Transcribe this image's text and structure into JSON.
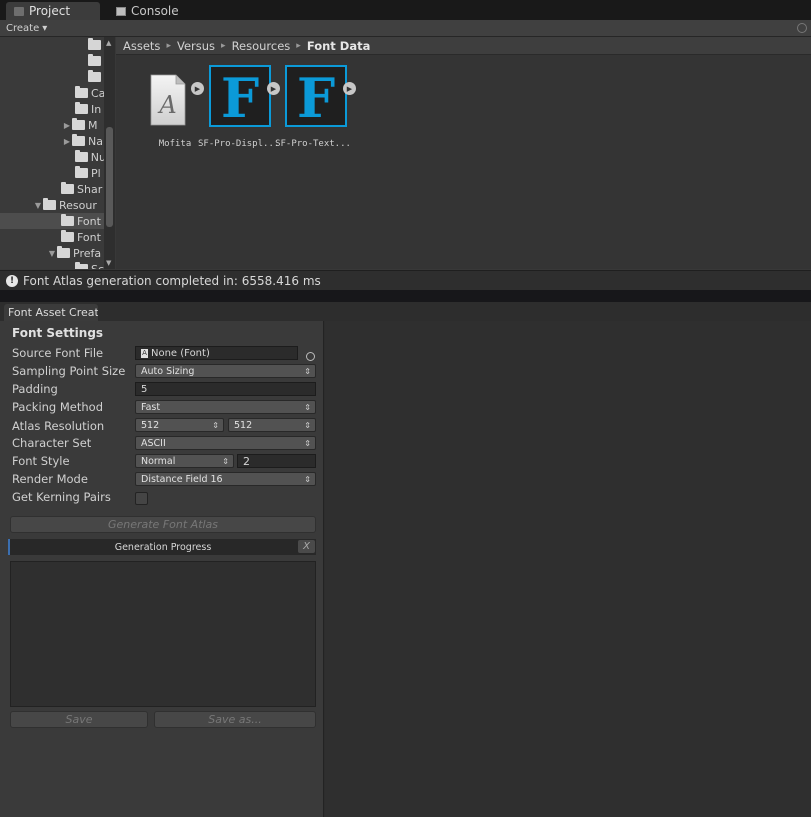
{
  "project": {
    "tabs": {
      "project": "Project",
      "console": "Console"
    },
    "toolbar": {
      "create": "Create",
      "create_arrow": "▾"
    },
    "tree": [
      {
        "label": "",
        "arrow": ""
      },
      {
        "label": "",
        "arrow": ""
      },
      {
        "label": "",
        "arrow": ""
      },
      {
        "label": "Ca",
        "arrow": ""
      },
      {
        "label": "In",
        "arrow": ""
      },
      {
        "label": "M",
        "arrow": "▶"
      },
      {
        "label": "Na",
        "arrow": "▶"
      },
      {
        "label": "Nu",
        "arrow": ""
      },
      {
        "label": "Pl",
        "arrow": ""
      },
      {
        "label": "Shar",
        "arrow": ""
      },
      {
        "label": "Resour",
        "arrow": "▼"
      },
      {
        "label": "Font",
        "arrow": ""
      },
      {
        "label": "Font",
        "arrow": ""
      },
      {
        "label": "Prefa",
        "arrow": "▼"
      },
      {
        "label": "Sc",
        "arrow": ""
      }
    ],
    "breadcrumb": [
      "Assets",
      "Versus",
      "Resources",
      "Font Data"
    ],
    "breadcrumb_separator": "▸",
    "assets": [
      {
        "label": "Mofita",
        "kind": "font-file",
        "glyph": "A"
      },
      {
        "label": "SF-Pro-Displ...",
        "kind": "font-asset",
        "glyph": "F"
      },
      {
        "label": "SF-Pro-Text...",
        "kind": "font-asset",
        "glyph": "F"
      }
    ],
    "status_text": "Font Atlas generation completed in: 6558.416 ms"
  },
  "font_asset_creator": {
    "tab_label": "Font Asset Creat",
    "section_title": "Font Settings",
    "labels": {
      "source_font_file": "Source Font File",
      "sampling_point_size": "Sampling Point Size",
      "padding": "Padding",
      "packing_method": "Packing Method",
      "atlas_resolution": "Atlas Resolution",
      "character_set": "Character Set",
      "font_style": "Font Style",
      "render_mode": "Render Mode",
      "get_kerning_pairs": "Get Kerning Pairs"
    },
    "values": {
      "source_font_file": "None (Font)",
      "sampling_point_size": "Auto Sizing",
      "padding": "5",
      "packing_method": "Fast",
      "atlas_width": "512",
      "atlas_height": "512",
      "character_set": "ASCII",
      "font_style": "Normal",
      "font_style_value": "2",
      "render_mode": "Distance Field 16",
      "get_kerning_pairs": false
    },
    "buttons": {
      "generate": "Generate Font Atlas",
      "progress_label": "Generation Progress",
      "progress_close": "X",
      "save": "Save",
      "save_as": "Save as..."
    }
  },
  "colors": {
    "selection_accent": "#3b6fb0",
    "font_asset_blue": "#0b9ad8"
  }
}
